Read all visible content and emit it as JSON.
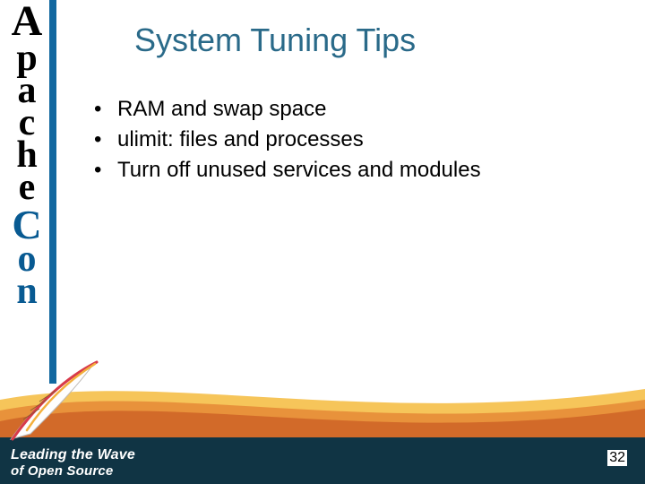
{
  "title": "System Tuning Tips",
  "bullets": {
    "b0": "RAM and swap space",
    "b1": "ulimit: files and processes",
    "b2": "Turn off unused services and modules"
  },
  "sidebar": {
    "brand": "ApacheCon"
  },
  "footer": {
    "line1": "Leading the Wave",
    "line2": "of Open Source"
  },
  "page": {
    "number": "32"
  },
  "colors": {
    "title": "#2a6a89",
    "accent": "#1268a0",
    "footer_bg": "#103444",
    "swoosh_top": "#f6c55a",
    "swoosh_mid": "#e8923b",
    "feather_stroke": "#d83a4a"
  }
}
